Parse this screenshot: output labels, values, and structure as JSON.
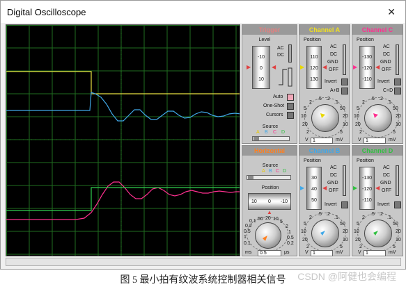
{
  "window": {
    "title": "Digital Oscilloscope",
    "close_glyph": "✕"
  },
  "colors": {
    "channel_a": "#f0e020",
    "channel_b": "#40b0f0",
    "channel_c": "#ff3090",
    "channel_d": "#30d050",
    "trigger": "#f08080",
    "horizontal": "#ff8020"
  },
  "trigger": {
    "title": "Trigger",
    "level_label": "Level",
    "level_ticks": [
      "-10",
      "0",
      "10"
    ],
    "ac": "AC",
    "dc": "DC",
    "auto": "Auto",
    "one_shot": "One-Shot",
    "cursors": "Cursors",
    "source_label": "Source",
    "source_letters": [
      "A",
      "B",
      "C",
      "D"
    ]
  },
  "channel_a": {
    "title": "Channel A",
    "position_label": "Position",
    "position_ticks": [
      "110",
      "120",
      "130"
    ],
    "ac": "AC",
    "dc": "DC",
    "gnd": "GND",
    "off": "OFF",
    "invert": "Invert",
    "combine": "A+B",
    "knob_ticks": [
      "20",
      "10",
      "5",
      "2",
      ".5",
      ".2",
      ".1",
      "50",
      "20",
      "10",
      "5",
      "2"
    ],
    "v_label": "V",
    "value": "1",
    "unit": "mV"
  },
  "channel_c": {
    "title": "Channel C",
    "position_label": "Position",
    "position_ticks": [
      "-130",
      "-120",
      "-110"
    ],
    "ac": "AC",
    "dc": "DC",
    "gnd": "GND",
    "off": "OFF",
    "invert": "Invert",
    "combine": "C+D",
    "knob_ticks": [
      "20",
      "10",
      "5",
      "2",
      ".5",
      ".2",
      ".1",
      "50",
      "20",
      "10",
      "5",
      "2"
    ],
    "v_label": "V",
    "value": "1",
    "unit": "mV"
  },
  "horizontal": {
    "title": "Horizontal",
    "source_label": "Source",
    "source_letters": [
      "A",
      "B",
      "C",
      "D"
    ],
    "position_label": "Position",
    "position_ticks": [
      "10",
      "0",
      "-10"
    ],
    "knob_ticks": [
      "1",
      "0.5",
      "0.2",
      "0.1",
      "50",
      "20",
      "10",
      "5",
      "2",
      "1",
      "0.5",
      "0.2",
      "0.1"
    ],
    "ms_label": "ms",
    "value": "0.5",
    "unit": "μs"
  },
  "channel_b": {
    "title": "Channel B",
    "position_label": "Position",
    "position_ticks": [
      "30",
      "40",
      "50"
    ],
    "ac": "AC",
    "dc": "DC",
    "gnd": "GND",
    "off": "OFF",
    "invert": "Invert",
    "knob_ticks": [
      "20",
      "10",
      "5",
      "2",
      ".5",
      ".2",
      ".1",
      "50",
      "20",
      "10",
      "5",
      "2"
    ],
    "v_label": "V",
    "value": "1",
    "unit": "mV"
  },
  "channel_d": {
    "title": "Channel D",
    "position_label": "Position",
    "position_ticks": [
      "-130",
      "-120",
      "-110"
    ],
    "ac": "AC",
    "dc": "DC",
    "gnd": "GND",
    "off": "OFF",
    "invert": "Invert",
    "knob_ticks": [
      "20",
      "10",
      "5",
      "2",
      ".5",
      ".2",
      ".1",
      "50",
      "20",
      "10",
      "5",
      "2"
    ],
    "v_label": "V",
    "value": "1",
    "unit": "mV"
  },
  "caption": "图 5  最小拍有纹波系统控制器相关信号",
  "watermark": "CSDN @阿健也会编程"
}
